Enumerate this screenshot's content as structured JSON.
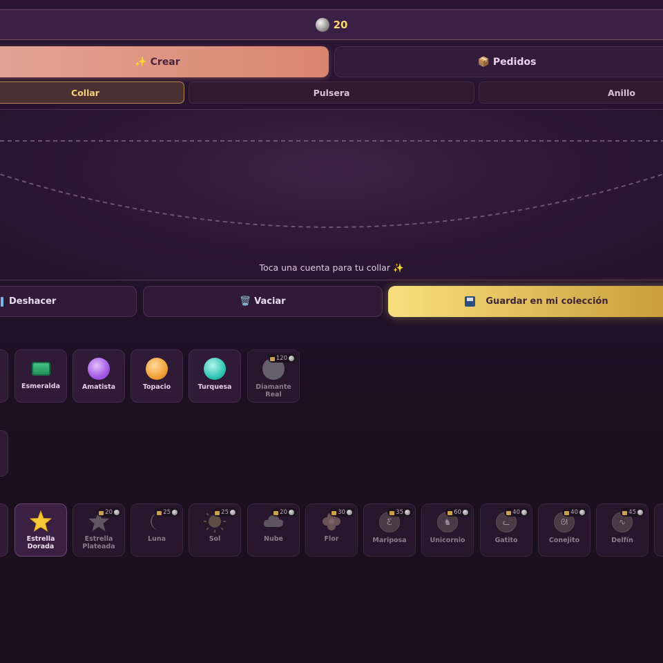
{
  "header": {
    "coins": "20"
  },
  "main_tabs": [
    {
      "label": "✨ Crear"
    },
    {
      "label": "📦 Pedidos"
    }
  ],
  "sub_tabs": [
    {
      "label": "Collar"
    },
    {
      "label": "Pulsera"
    },
    {
      "label": "Anillo"
    }
  ],
  "hint": "Toca una cuenta para tu collar ✨",
  "actions": {
    "undo": "Deshacer",
    "clear": "🗑️ Vaciar",
    "save": "Guardar en mi colección"
  },
  "gems": [
    {
      "name": "Esmeralda",
      "color": "#2fa56d",
      "locked": false
    },
    {
      "name": "Amatista",
      "color": "#b06ee8",
      "locked": false
    },
    {
      "name": "Topacio",
      "color": "#f0a13a",
      "locked": false
    },
    {
      "name": "Turquesa",
      "color": "#31c7b6",
      "locked": false
    },
    {
      "name": "Diamante Real",
      "color": "#6a6470",
      "locked": true,
      "price": "120"
    }
  ],
  "charms": [
    {
      "name": "Estrella Dorada",
      "icon": "star-icon",
      "locked": false
    },
    {
      "name": "Estrella Plateada",
      "icon": "star-icon",
      "locked": true,
      "price": "20"
    },
    {
      "name": "Luna",
      "icon": "moon-icon",
      "locked": true,
      "price": "25"
    },
    {
      "name": "Sol",
      "icon": "sun-icon",
      "locked": true,
      "price": "25"
    },
    {
      "name": "Nube",
      "icon": "cloud-icon",
      "locked": true,
      "price": "20"
    },
    {
      "name": "Flor",
      "icon": "flower-icon",
      "locked": true,
      "price": "30"
    },
    {
      "name": "Mariposa",
      "icon": "butterfly-icon",
      "locked": true,
      "price": "35"
    },
    {
      "name": "Unicornio",
      "icon": "unicorn-icon",
      "locked": true,
      "price": "60"
    },
    {
      "name": "Gatito",
      "icon": "cat-icon",
      "locked": true,
      "price": "40"
    },
    {
      "name": "Conejito",
      "icon": "rabbit-icon",
      "locked": true,
      "price": "40"
    },
    {
      "name": "Delfín",
      "icon": "dolphin-icon",
      "locked": true,
      "price": "45"
    }
  ]
}
